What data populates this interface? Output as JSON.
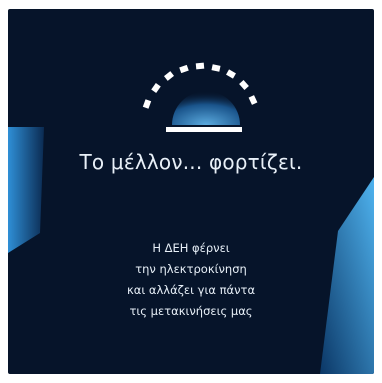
{
  "ad": {
    "headline": "Το μέλλον... φορτίζει.",
    "body_lines": [
      "Η ΔΕΗ φέρνει",
      "την ηλεκτροκίνηση",
      "και αλλάζει για πάντα",
      "τις μετακινήσεις μας"
    ],
    "icon": "battery-charging-gauge-icon",
    "colors": {
      "background": "#06142a",
      "accent_blue": "#3aa3e6",
      "text": "#e8f0f8"
    }
  }
}
